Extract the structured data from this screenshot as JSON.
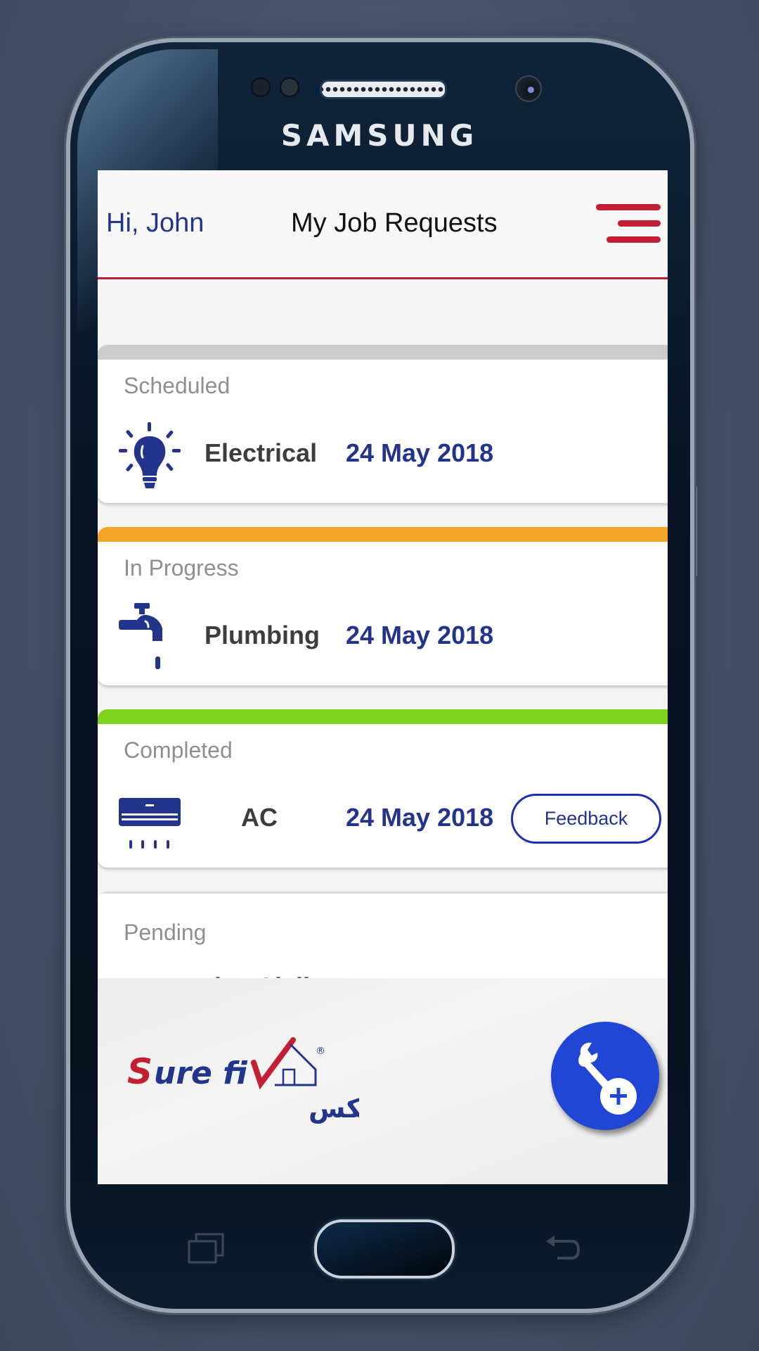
{
  "device": {
    "brand": "SAMSUNG",
    "nav_keys": [
      {
        "name": "recent-apps",
        "icon": "recent-apps-icon"
      },
      {
        "name": "home",
        "icon": "home-button"
      },
      {
        "name": "back",
        "icon": "back-icon"
      }
    ]
  },
  "header": {
    "greeting": "Hi, John",
    "title": "My Job Requests",
    "menu_icon": "hamburger-menu-icon",
    "accent_color": "#c41e32"
  },
  "jobs": [
    {
      "status": "Scheduled",
      "status_color": "#cccccc",
      "service": "Electrical",
      "icon": "lightbulb-icon",
      "date": "24 May 2018"
    },
    {
      "status": "In Progress",
      "status_color": "#f2a526",
      "service": "Plumbing",
      "icon": "faucet-icon",
      "date": "24 May 2018"
    },
    {
      "status": "Completed",
      "status_color": "#7ed321",
      "service": "AC",
      "icon": "air-conditioner-icon",
      "date": "24 May 2018",
      "action_label": "Feedback"
    },
    {
      "status": "Pending",
      "status_color": "#e0e0e0",
      "service": "Misc Civil",
      "icon": "civil-works-icon",
      "date": ""
    }
  ],
  "footer": {
    "logo_text_en": "Sure Fix",
    "logo_text_ar": "شوور فيكس",
    "logo_registered": "®",
    "fab_icon": "add-service-wrench-icon",
    "brand_blue": "#2145d4",
    "brand_red": "#c41e32"
  }
}
